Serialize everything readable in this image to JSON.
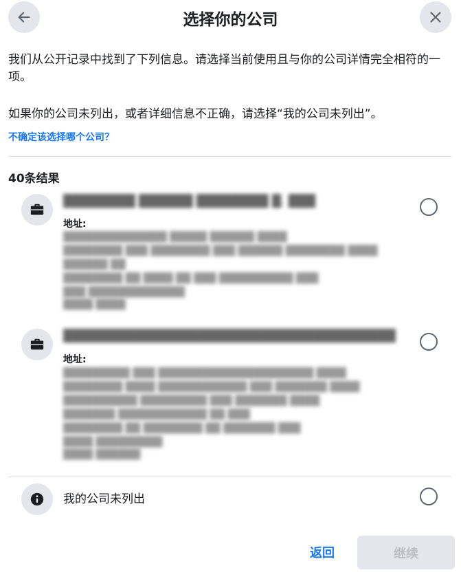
{
  "header": {
    "title": "选择你的公司"
  },
  "intro": {
    "description": "我们从公开记录中找到了下列信息。请选择当前使用且与你的公司详情完全相符的一项。",
    "instruction": "如果你的公司未列出，或者详细信息不正确，请选择“我的公司未列出”。",
    "help_link": "不确定该选择哪个公司？"
  },
  "results": {
    "count_label": "40条结果",
    "items": [
      {
        "name": "████████ ██████ ████████ █. ███",
        "address_label": "地址:",
        "address_lines": [
          "██████████████ █████ ██████ ████",
          "████████ ███ ████████ ███ ██████ ████████ ████",
          "██████ ██",
          "████████ ██ ████ ██ ███ ██████████ ███",
          "███ █████████████",
          "████ ████"
        ]
      },
      {
        "name": "█████████████████████████████████████",
        "address_label": "地址:",
        "address_lines": [
          "█████████ ███ █████████████████████ ████",
          "████████ ████ ████████████ ███ ███████ ████",
          "██████████ █████████ ███ ███████ ████",
          "███████ ████████████ ██ ███",
          "████████ ██ ████████ ██ ███████ ███",
          "████ █████████",
          "████ ██████"
        ]
      }
    ],
    "not_listed_label": "我的公司未列出"
  },
  "footer": {
    "back_label": "返回",
    "continue_label": "继续"
  },
  "colors": {
    "accent": "#1877f2",
    "icon_bg": "#e4e6eb",
    "divider": "#dadde1",
    "disabled_text": "#bcc0c4"
  },
  "icons": {
    "back": "arrow-left-icon",
    "close": "close-icon",
    "company": "briefcase-icon",
    "info": "info-icon"
  }
}
